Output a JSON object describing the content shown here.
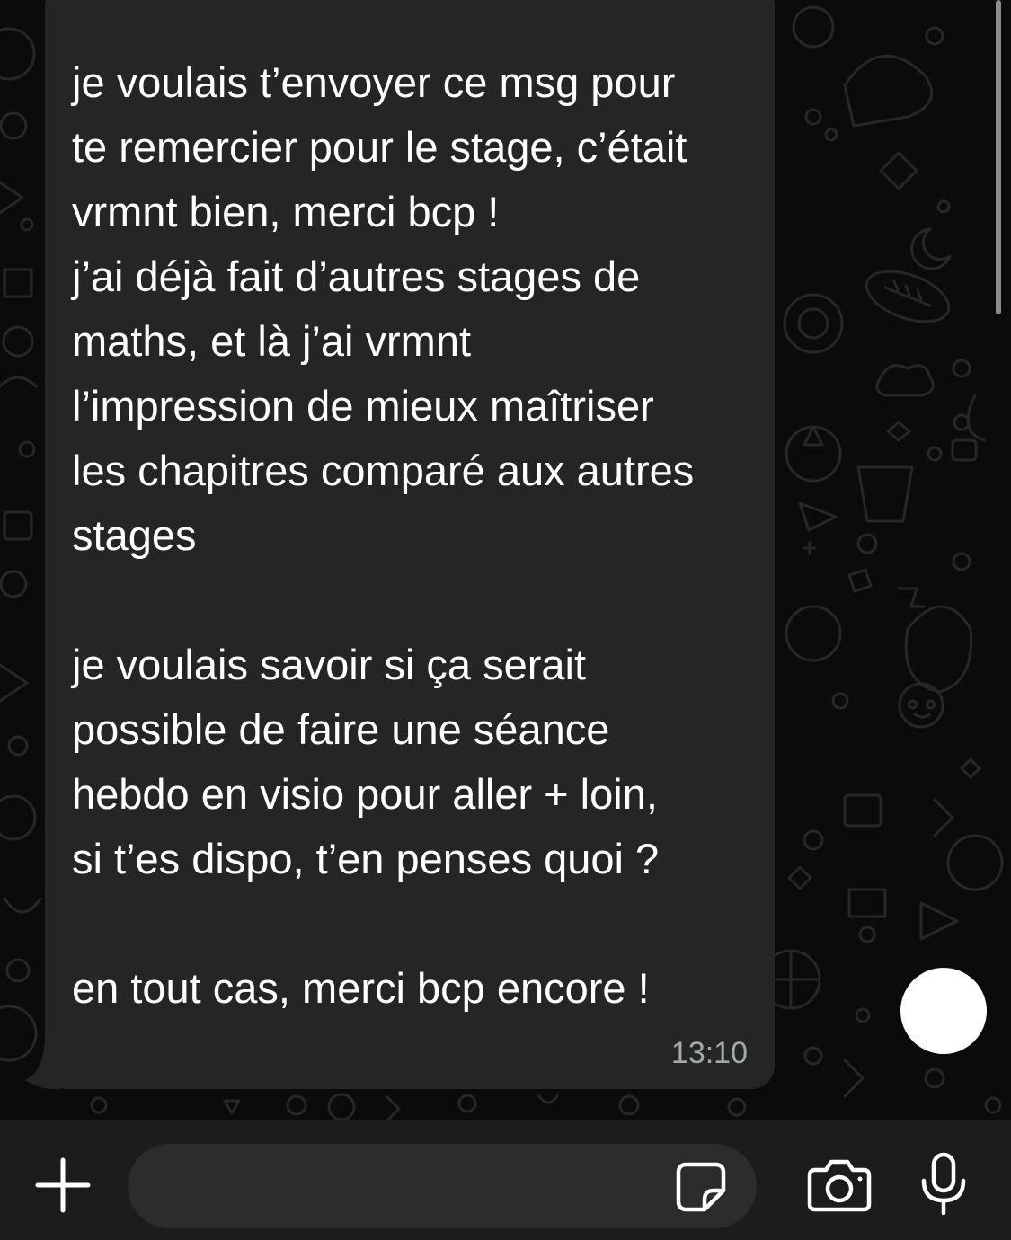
{
  "message": {
    "paragraphs": [
      "je voulais t’envoyer ce msg pour te remercier pour le stage, c’était vrmnt bien, merci bcp ! j’ai déjà fait d’autres stages de maths, et là j’ai vrmnt l’impression de mieux maîtriser les chapitres comparé aux autres stages",
      "je voulais savoir si ça serait possible de faire une séance hebdo en visio pour aller + loin, si t’es dispo, t’en penses quoi ?",
      "en tout cas, merci bcp encore !"
    ],
    "lines": [
      "je voulais t’envoyer ce msg pour",
      "te remercier pour le stage, c’était",
      "vrmnt bien, merci bcp !",
      "j’ai déjà fait d’autres stages de",
      "maths, et là j’ai vrmnt",
      "l’impression de mieux maîtriser",
      "les chapitres comparé aux autres",
      "stages",
      "je voulais savoir si ça serait",
      "possible de faire une séance",
      "hebdo en visio pour aller + loin,",
      "si t’es dispo, t’en penses quoi ?",
      "en tout cas, merci bcp encore !"
    ],
    "time": "13:10"
  },
  "composer": {
    "input_value": "",
    "input_placeholder": ""
  },
  "icons": {
    "attach": "plus-icon",
    "sticker": "sticker-icon",
    "camera": "camera-icon",
    "mic": "microphone-icon",
    "scroll_fab": "scroll-down-button"
  },
  "colors": {
    "chat_background": "#0b0b0b",
    "bubble": "#242626",
    "message_text": "#ffffff",
    "timestamp": "#a6a9a9",
    "bottom_bar": "#1b1c1c",
    "input_field": "#2b2c2c"
  }
}
